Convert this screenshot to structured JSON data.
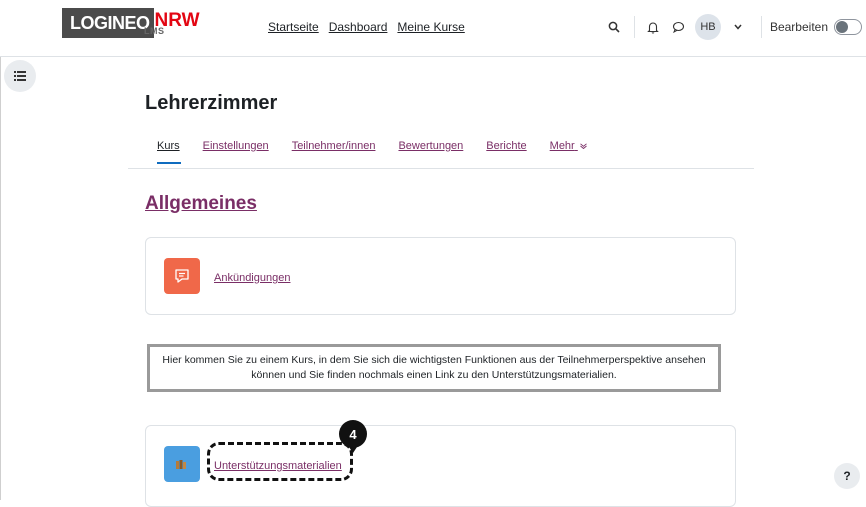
{
  "brand": {
    "logo_main": "LOGINEO",
    "logo_accent": "NRW",
    "logo_sub": "LMS"
  },
  "nav": {
    "links": [
      "Startseite",
      "Dashboard",
      "Meine Kurse"
    ]
  },
  "user": {
    "initials": "HB",
    "edit_label": "Bearbeiten"
  },
  "course": {
    "title": "Lehrerzimmer",
    "tabs": [
      "Kurs",
      "Einstellungen",
      "Teilnehmer/innen",
      "Bewertungen",
      "Berichte",
      "Mehr"
    ],
    "active_tab": "Kurs"
  },
  "section": {
    "title": "Allgemeines",
    "activities": [
      {
        "name": "Ankündigungen",
        "icon": "forum-icon"
      },
      {
        "name": "Unterstützungsmaterialien",
        "icon": "folder-icon"
      }
    ],
    "info_text": "Hier kommen Sie zu einem Kurs, in dem Sie sich die wichtigsten Funktionen aus der Teilnehmerperspektive ansehen können und Sie finden nochmals einen Link zu den Unterstützungsmaterialien."
  },
  "callout": {
    "number": "4"
  },
  "help": {
    "label": "?"
  },
  "colors": {
    "link": "#7a2e66",
    "forum": "#f06849",
    "folder": "#4a9ee0",
    "brand_red": "#e30613"
  }
}
